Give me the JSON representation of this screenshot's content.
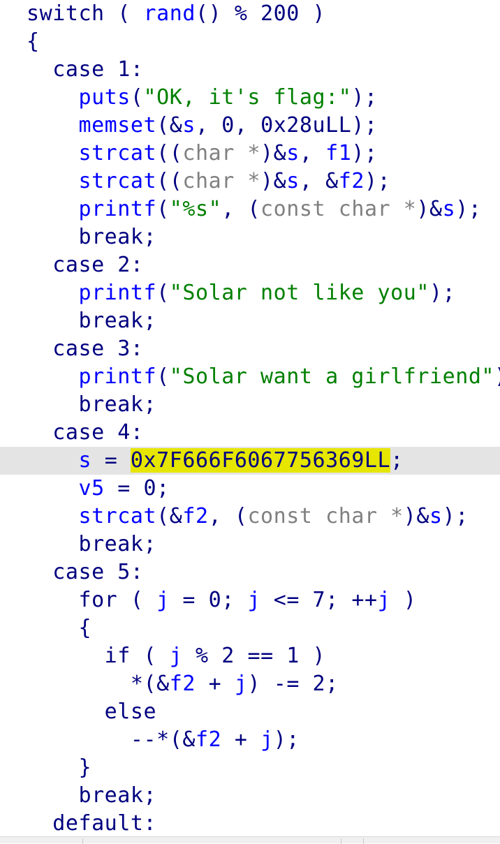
{
  "editor": {
    "highlighted_line": 16,
    "lines": [
      {
        "indent": "",
        "tokens": [
          [
            "kw",
            "switch"
          ],
          [
            "punc",
            " ( "
          ],
          [
            "fn",
            "rand"
          ],
          [
            "punc",
            "() "
          ],
          [
            "op",
            "% "
          ],
          [
            "num",
            "200"
          ],
          [
            "punc",
            " )"
          ]
        ]
      },
      {
        "indent": "",
        "tokens": [
          [
            "punc",
            "{"
          ]
        ]
      },
      {
        "indent": "  ",
        "tokens": [
          [
            "kw",
            "case "
          ],
          [
            "num",
            "1"
          ],
          [
            "punc",
            ":"
          ]
        ]
      },
      {
        "indent": "    ",
        "tokens": [
          [
            "fn",
            "puts"
          ],
          [
            "punc",
            "("
          ],
          [
            "str",
            "\"OK, it's flag:\""
          ],
          [
            "punc",
            ");"
          ]
        ]
      },
      {
        "indent": "    ",
        "tokens": [
          [
            "fn",
            "memset"
          ],
          [
            "punc",
            "(&"
          ],
          [
            "var",
            "s"
          ],
          [
            "punc",
            ", "
          ],
          [
            "num",
            "0"
          ],
          [
            "punc",
            ", "
          ],
          [
            "num",
            "0x28uLL"
          ],
          [
            "punc",
            ");"
          ]
        ]
      },
      {
        "indent": "    ",
        "tokens": [
          [
            "fn",
            "strcat"
          ],
          [
            "punc",
            "(("
          ],
          [
            "type",
            "char *"
          ],
          [
            "punc",
            ")&"
          ],
          [
            "var",
            "s"
          ],
          [
            "punc",
            ", "
          ],
          [
            "var2",
            "f1"
          ],
          [
            "punc",
            ");"
          ]
        ]
      },
      {
        "indent": "    ",
        "tokens": [
          [
            "fn",
            "strcat"
          ],
          [
            "punc",
            "(("
          ],
          [
            "type",
            "char *"
          ],
          [
            "punc",
            ")&"
          ],
          [
            "var",
            "s"
          ],
          [
            "punc",
            ", &"
          ],
          [
            "var2",
            "f2"
          ],
          [
            "punc",
            ");"
          ]
        ]
      },
      {
        "indent": "    ",
        "tokens": [
          [
            "fn",
            "printf"
          ],
          [
            "punc",
            "("
          ],
          [
            "str",
            "\"%s\""
          ],
          [
            "punc",
            ", ("
          ],
          [
            "type",
            "const char *"
          ],
          [
            "punc",
            ")&"
          ],
          [
            "var",
            "s"
          ],
          [
            "punc",
            ");"
          ]
        ]
      },
      {
        "indent": "    ",
        "tokens": [
          [
            "kw",
            "break"
          ],
          [
            "punc",
            ";"
          ]
        ]
      },
      {
        "indent": "  ",
        "tokens": [
          [
            "kw",
            "case "
          ],
          [
            "num",
            "2"
          ],
          [
            "punc",
            ":"
          ]
        ]
      },
      {
        "indent": "    ",
        "tokens": [
          [
            "fn",
            "printf"
          ],
          [
            "punc",
            "("
          ],
          [
            "str",
            "\"Solar not like you\""
          ],
          [
            "punc",
            ");"
          ]
        ]
      },
      {
        "indent": "    ",
        "tokens": [
          [
            "kw",
            "break"
          ],
          [
            "punc",
            ";"
          ]
        ]
      },
      {
        "indent": "  ",
        "tokens": [
          [
            "kw",
            "case "
          ],
          [
            "num",
            "3"
          ],
          [
            "punc",
            ":"
          ]
        ]
      },
      {
        "indent": "    ",
        "tokens": [
          [
            "fn",
            "printf"
          ],
          [
            "punc",
            "("
          ],
          [
            "str",
            "\"Solar want a girlfriend\""
          ],
          [
            "punc",
            ");"
          ]
        ]
      },
      {
        "indent": "    ",
        "tokens": [
          [
            "kw",
            "break"
          ],
          [
            "punc",
            ";"
          ]
        ]
      },
      {
        "indent": "  ",
        "tokens": [
          [
            "kw",
            "case "
          ],
          [
            "num",
            "4"
          ],
          [
            "punc",
            ":"
          ]
        ]
      },
      {
        "indent": "    ",
        "tokens": [
          [
            "var",
            "s"
          ],
          [
            "op",
            " = "
          ],
          [
            "hlnum",
            "0x7F666F6067756369LL"
          ],
          [
            "punc",
            ";"
          ]
        ]
      },
      {
        "indent": "    ",
        "tokens": [
          [
            "var",
            "v5"
          ],
          [
            "op",
            " = "
          ],
          [
            "num",
            "0"
          ],
          [
            "punc",
            ";"
          ]
        ]
      },
      {
        "indent": "    ",
        "tokens": [
          [
            "fn",
            "strcat"
          ],
          [
            "punc",
            "(&"
          ],
          [
            "var2",
            "f2"
          ],
          [
            "punc",
            ", ("
          ],
          [
            "type",
            "const char *"
          ],
          [
            "punc",
            ")&"
          ],
          [
            "var",
            "s"
          ],
          [
            "punc",
            ");"
          ]
        ]
      },
      {
        "indent": "    ",
        "tokens": [
          [
            "kw",
            "break"
          ],
          [
            "punc",
            ";"
          ]
        ]
      },
      {
        "indent": "  ",
        "tokens": [
          [
            "kw",
            "case "
          ],
          [
            "num",
            "5"
          ],
          [
            "punc",
            ":"
          ]
        ]
      },
      {
        "indent": "    ",
        "tokens": [
          [
            "kw",
            "for"
          ],
          [
            "punc",
            " ( "
          ],
          [
            "var",
            "j"
          ],
          [
            "op",
            " = "
          ],
          [
            "num",
            "0"
          ],
          [
            "punc",
            "; "
          ],
          [
            "var",
            "j"
          ],
          [
            "op",
            " <= "
          ],
          [
            "num",
            "7"
          ],
          [
            "punc",
            "; "
          ],
          [
            "op",
            "++"
          ],
          [
            "var",
            "j"
          ],
          [
            "punc",
            " )"
          ]
        ]
      },
      {
        "indent": "    ",
        "tokens": [
          [
            "punc",
            "{"
          ]
        ]
      },
      {
        "indent": "      ",
        "tokens": [
          [
            "kw",
            "if"
          ],
          [
            "punc",
            " ( "
          ],
          [
            "var",
            "j"
          ],
          [
            "op",
            " % "
          ],
          [
            "num",
            "2"
          ],
          [
            "op",
            " == "
          ],
          [
            "num",
            "1"
          ],
          [
            "punc",
            " )"
          ]
        ]
      },
      {
        "indent": "        ",
        "tokens": [
          [
            "op",
            "*"
          ],
          [
            "punc",
            "(&"
          ],
          [
            "var2",
            "f2"
          ],
          [
            "op",
            " + "
          ],
          [
            "var",
            "j"
          ],
          [
            "punc",
            ")"
          ],
          [
            "op",
            " -= "
          ],
          [
            "num",
            "2"
          ],
          [
            "punc",
            ";"
          ]
        ]
      },
      {
        "indent": "      ",
        "tokens": [
          [
            "kw",
            "else"
          ]
        ]
      },
      {
        "indent": "        ",
        "tokens": [
          [
            "op",
            "--*"
          ],
          [
            "punc",
            "(&"
          ],
          [
            "var2",
            "f2"
          ],
          [
            "op",
            " + "
          ],
          [
            "var",
            "j"
          ],
          [
            "punc",
            ");"
          ]
        ]
      },
      {
        "indent": "    ",
        "tokens": [
          [
            "punc",
            "}"
          ]
        ]
      },
      {
        "indent": "    ",
        "tokens": [
          [
            "kw",
            "break"
          ],
          [
            "punc",
            ";"
          ]
        ]
      },
      {
        "indent": "  ",
        "tokens": [
          [
            "kw",
            "default"
          ],
          [
            "punc",
            ":"
          ]
        ]
      }
    ]
  }
}
